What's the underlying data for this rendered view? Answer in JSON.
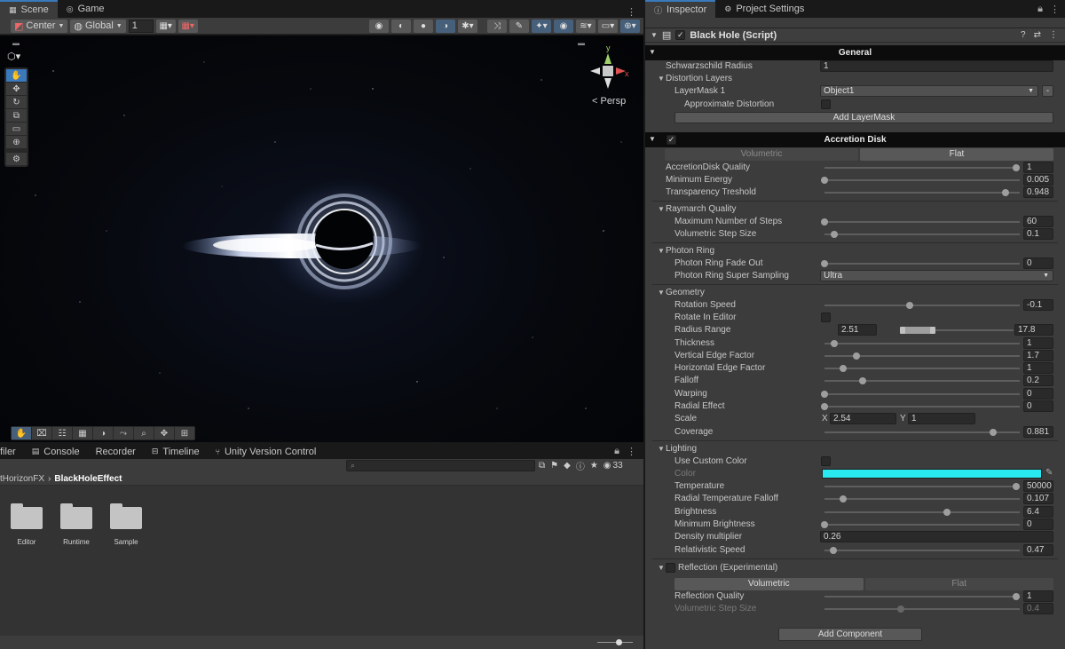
{
  "scene_tabs": [
    {
      "label": "Scene"
    },
    {
      "label": "Game"
    }
  ],
  "scene_toolbar": {
    "pivot": "Center",
    "space": "Global",
    "snap_value": "1"
  },
  "viewport": {
    "camera_mode": "< Persp",
    "gizmo_axes": {
      "y": "y",
      "x": "x"
    }
  },
  "project_tabs": [
    {
      "label": "filer"
    },
    {
      "label": "Console"
    },
    {
      "label": "Recorder"
    },
    {
      "label": "Timeline"
    },
    {
      "label": "Unity Version Control"
    }
  ],
  "project": {
    "hidden_count": "33",
    "breadcrumb": [
      "tHorizonFX",
      "BlackHoleEffect"
    ],
    "folders": [
      {
        "label": "Editor"
      },
      {
        "label": "Runtime"
      },
      {
        "label": "Sample"
      }
    ]
  },
  "inspector_tabs": [
    {
      "label": "Inspector"
    },
    {
      "label": "Project Settings"
    }
  ],
  "inspector": {
    "component_title": "Black Hole (Script)",
    "sections": {
      "general": "General",
      "accretion": "Accretion Disk",
      "raymarch": "Raymarch Quality",
      "photon": "Photon Ring",
      "geometry": "Geometry",
      "lighting": "Lighting",
      "reflection": "Reflection (Experimental)"
    },
    "general": {
      "schwarzschild_label": "Schwarzschild Radius",
      "schwarzschild_value": "1",
      "distortion_layers_label": "Distortion Layers",
      "layermask_label": "LayerMask 1",
      "layermask_value": "Object1",
      "approx_label": "Approximate Distortion",
      "add_layermask": "Add LayerMask",
      "remove_btn": "-"
    },
    "accretion": {
      "mode_volumetric": "Volumetric",
      "mode_flat": "Flat",
      "quality_label": "AccretionDisk Quality",
      "quality_value": "1",
      "min_energy_label": "Minimum Energy",
      "min_energy_value": "0.005",
      "transparency_label": "Transparency Treshold",
      "transparency_value": "0.948"
    },
    "raymarch": {
      "max_steps_label": "Maximum Number of Steps",
      "max_steps_value": "60",
      "step_size_label": "Volumetric Step Size",
      "step_size_value": "0.1"
    },
    "photon": {
      "fade_label": "Photon Ring Fade Out",
      "fade_value": "0",
      "ss_label": "Photon Ring Super Sampling",
      "ss_value": "Ultra"
    },
    "geometry": {
      "rotation_speed_label": "Rotation Speed",
      "rotation_speed_value": "-0.1",
      "rotate_editor_label": "Rotate In Editor",
      "radius_range_label": "Radius Range",
      "radius_min": "2.51",
      "radius_max": "17.8",
      "thickness_label": "Thickness",
      "thickness_value": "1",
      "vedge_label": "Vertical Edge Factor",
      "vedge_value": "1.7",
      "hedge_label": "Horizontal Edge Factor",
      "hedge_value": "1",
      "falloff_label": "Falloff",
      "falloff_value": "0.2",
      "warping_label": "Warping",
      "warping_value": "0",
      "radial_label": "Radial Effect",
      "radial_value": "0",
      "scale_label": "Scale",
      "scale_x_label": "X",
      "scale_x": "2.54",
      "scale_y_label": "Y",
      "scale_y": "1",
      "coverage_label": "Coverage",
      "coverage_value": "0.881"
    },
    "lighting": {
      "custom_color_label": "Use Custom Color",
      "color_label": "Color",
      "color_hex": "#28e8f0",
      "temperature_label": "Temperature",
      "temperature_value": "50000",
      "radial_temp_label": "Radial Temperature Falloff",
      "radial_temp_value": "0.107",
      "brightness_label": "Brightness",
      "brightness_value": "6.4",
      "min_brightness_label": "Minimum Brightness",
      "min_brightness_value": "0",
      "density_label": "Density multiplier",
      "density_value": "0.26",
      "relativistic_label": "Relativistic Speed",
      "relativistic_value": "0.47"
    },
    "reflection": {
      "mode_volumetric": "Volumetric",
      "mode_flat": "Flat",
      "quality_label": "Reflection Quality",
      "quality_value": "1",
      "step_size_label": "Volumetric Step Size",
      "step_size_value": "0.4"
    },
    "add_component": "Add Component"
  },
  "colors": {
    "accent_blue": "#3a79bb",
    "panel": "#3c3c3c",
    "section_bar": "#0c0c0c"
  }
}
